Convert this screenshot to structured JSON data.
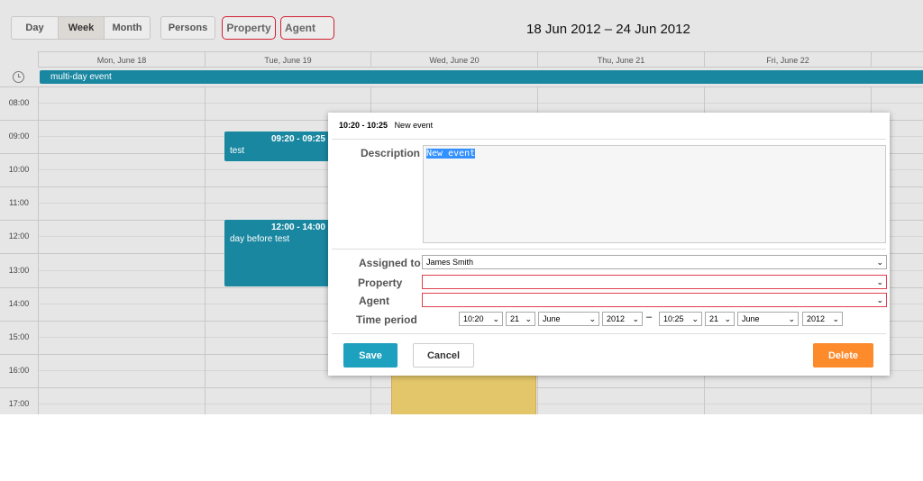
{
  "toolbar": {
    "views": [
      "Day",
      "Week",
      "Month"
    ],
    "active_view": "Week",
    "persons": "Persons",
    "property": "Property",
    "agent": "Agent",
    "date_range": "18 Jun 2012 – 24 Jun 2012"
  },
  "days": [
    "Mon, June 18",
    "Tue, June 19",
    "Wed, June 20",
    "Thu, June 21",
    "Fri, June 22"
  ],
  "allday_event": "multi-day event",
  "hours": [
    "08:00",
    "09:00",
    "10:00",
    "11:00",
    "12:00",
    "13:00",
    "14:00",
    "15:00",
    "16:00",
    "17:00"
  ],
  "events": [
    {
      "time": "09:20 - 09:25",
      "text": "test"
    },
    {
      "time": "12:00 - 14:00",
      "text": "day before test"
    }
  ],
  "colors": {
    "event": "#1a87a0",
    "yellow_event": "#e3c66a",
    "save": "#1ea0bf",
    "delete": "#fd8a2b",
    "highlight": "#e03040"
  },
  "modal": {
    "time": "10:20 - 10:25",
    "title": "New event",
    "description_label": "Description",
    "description_value": "New event",
    "assigned_label": "Assigned to",
    "assigned_value": "James Smith",
    "property_label": "Property",
    "property_value": "",
    "agent_label": "Agent",
    "agent_value": "",
    "period_label": "Time period",
    "start": {
      "time": "10:20",
      "day": "21",
      "month": "June",
      "year": "2012"
    },
    "dash": "–",
    "end": {
      "time": "10:25",
      "day": "21",
      "month": "June",
      "year": "2012"
    },
    "save": "Save",
    "cancel": "Cancel",
    "delete": "Delete"
  }
}
